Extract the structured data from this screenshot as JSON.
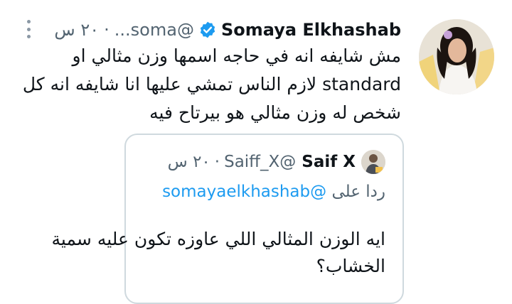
{
  "tweet": {
    "author_name": "Somaya Elkhashab",
    "handle": "@soma...",
    "time": "٢٠ س",
    "separator": "·",
    "text_lines": [
      "مش شايفه انه في حاجه اسمها وزن مثالي او",
      "standard لازم الناس تمشي عليها انا شايفه انه كل",
      "شخص له وزن مثالي هو بيرتاح فيه"
    ]
  },
  "quoted": {
    "author_name": "Saif X",
    "handle": "@Saiff_X",
    "time": "٢٠ س",
    "separator": "·",
    "reply_prefix": "ردا على",
    "reply_to": "@somayaelkhashab",
    "text_lines": [
      "ايه الوزن المثالي اللي عاوزه تكون عليه سمية",
      "الخشاب؟"
    ]
  },
  "icons": {
    "verified": "verified-badge-icon",
    "more": "more-vertical-icon"
  },
  "colors": {
    "verified": "#1d9bf0",
    "secondary_text": "#536471",
    "mention": "#1d9bf0",
    "border": "#cfd9de"
  }
}
